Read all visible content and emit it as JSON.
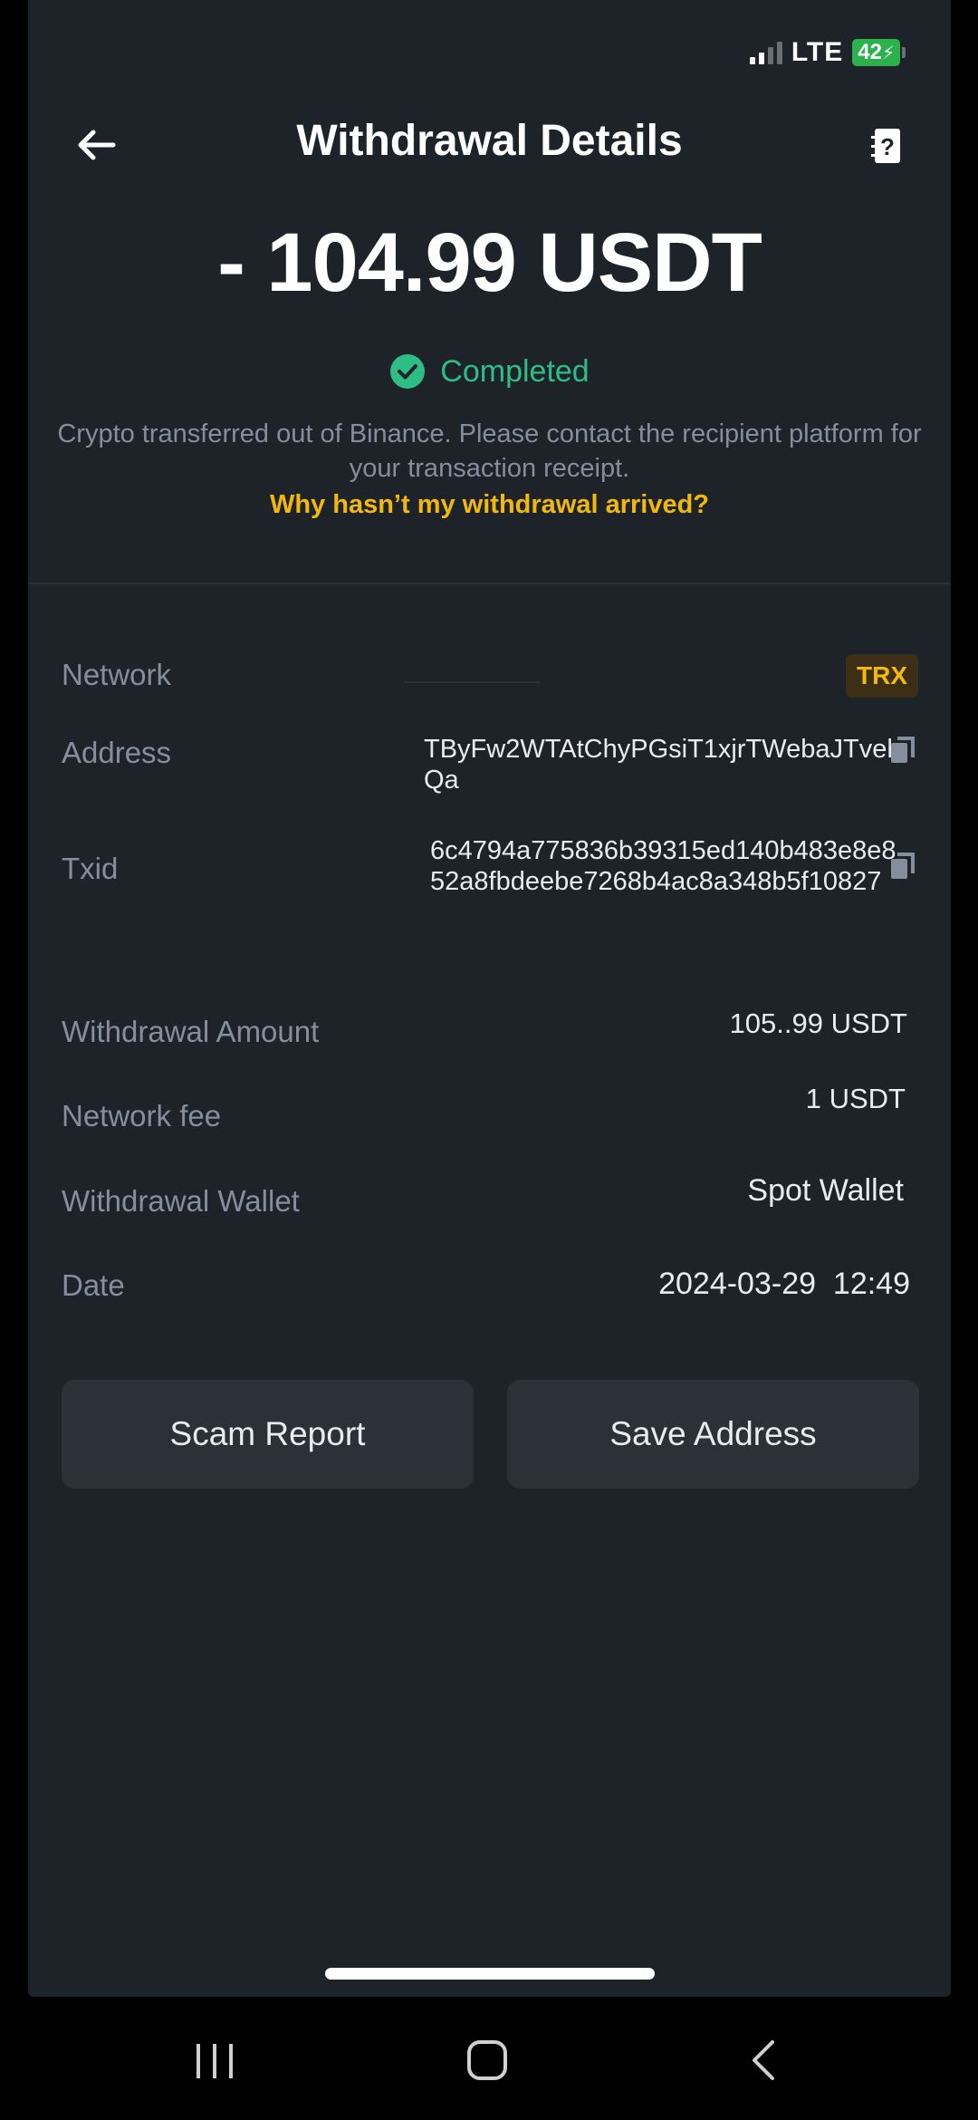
{
  "status_bar": {
    "network": "LTE",
    "battery": "42"
  },
  "header": {
    "title": "Withdrawal Details"
  },
  "amount": "- 104.99 USDT",
  "status": "Completed",
  "info_text": "Crypto transferred out of Binance. Please contact the recipient platform for your transaction receipt.",
  "help_link": "Why hasn’t my withdrawal arrived?",
  "details": {
    "network_label": "Network",
    "network_value": "TRX",
    "address_label": "Address",
    "address_value": "TByFw2WTAtChyPGsiT1xjrTWebaJTvehQa",
    "txid_label": "Txid",
    "txid_value": "6c4794a775836b39315ed140b483e8e852a8fbdeebe7268b4ac8a348b5f10827",
    "withdrawal_amount_label": "Withdrawal Amount",
    "withdrawal_amount_value": "105..99 USDT",
    "network_fee_label": "Network fee",
    "network_fee_value": "1 USDT",
    "withdrawal_wallet_label": "Withdrawal Wallet",
    "withdrawal_wallet_value": "Spot Wallet",
    "date_label": "Date",
    "date_value": "2024-03-29  12:49"
  },
  "buttons": {
    "scam_report": "Scam Report",
    "save_address": "Save Address"
  },
  "colors": {
    "background": "#1e2329",
    "accent": "#f0b90b",
    "success": "#2ebd85",
    "muted_text": "#848e9c",
    "button_bg": "#2b3139"
  },
  "icons": {
    "back": "arrow-left-icon",
    "help": "help-document-icon",
    "status": "check-circle-icon",
    "copy": "copy-icon"
  }
}
